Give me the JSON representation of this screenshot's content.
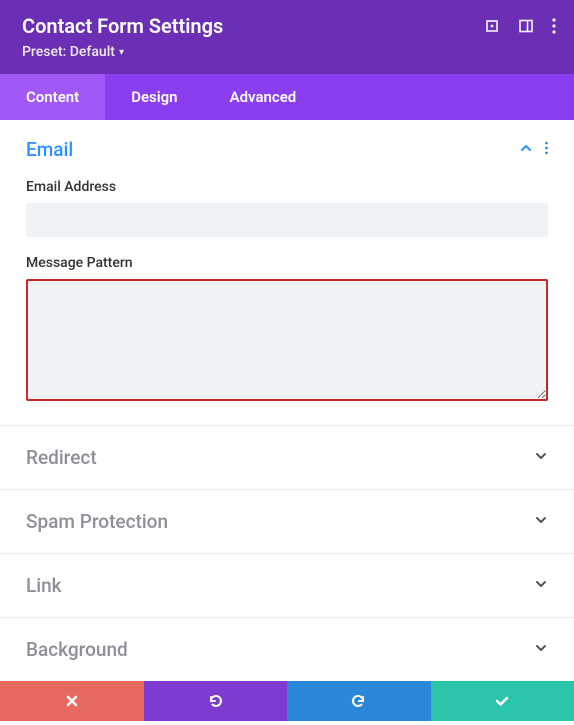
{
  "header": {
    "title": "Contact Form Settings",
    "preset": "Preset: Default"
  },
  "tabs": {
    "content": "Content",
    "design": "Design",
    "advanced": "Advanced"
  },
  "sections": {
    "email": {
      "title": "Email",
      "email_label": "Email Address",
      "email_value": "",
      "pattern_label": "Message Pattern",
      "pattern_value": ""
    },
    "redirect": {
      "title": "Redirect"
    },
    "spam": {
      "title": "Spam Protection"
    },
    "link": {
      "title": "Link"
    },
    "background": {
      "title": "Background"
    }
  }
}
